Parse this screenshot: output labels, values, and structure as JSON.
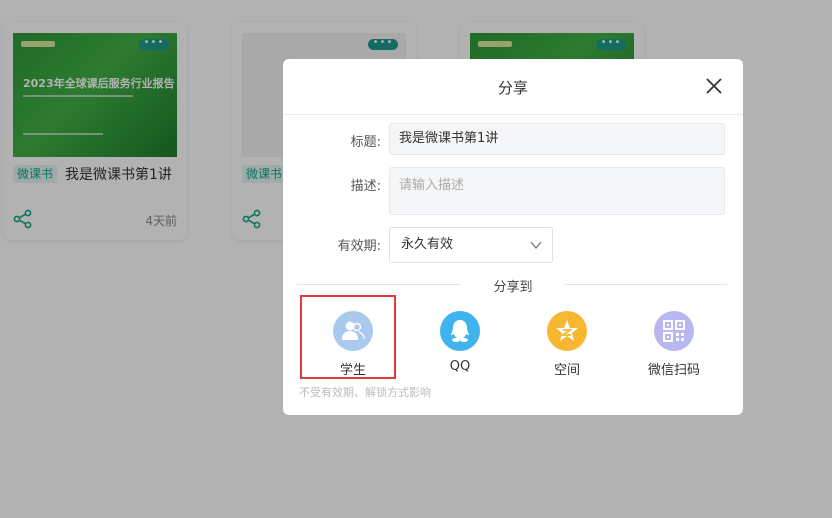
{
  "cards": [
    {
      "cover_title": "2023年全球课后服务行业报告",
      "tag": "微课书",
      "title": "我是微课书第1讲",
      "time": "4天前"
    },
    {
      "tag": "微课书"
    },
    {}
  ],
  "dialog": {
    "title": "分享",
    "title_label": "标题:",
    "title_value": "我是微课书第1讲",
    "desc_label": "描述:",
    "desc_placeholder": "请输入描述",
    "expiry_label": "有效期:",
    "expiry_value": "永久有效",
    "share_to": "分享到",
    "targets": [
      {
        "label": "学生",
        "icon": "student-icon",
        "color": "#a9c9ee"
      },
      {
        "label": "QQ",
        "icon": "qq-icon",
        "color": "#3fb3ee"
      },
      {
        "label": "空间",
        "icon": "qzone-icon",
        "color": "#f7b731"
      },
      {
        "label": "微信扫码",
        "icon": "qrcode-icon",
        "color": "#b9b7f2"
      }
    ],
    "hint": "不受有效期、解锁方式影响"
  },
  "colors": {
    "accent": "#17a589",
    "highlight": "#e0393e",
    "overlay": "rgba(0,0,0,0.30)"
  }
}
